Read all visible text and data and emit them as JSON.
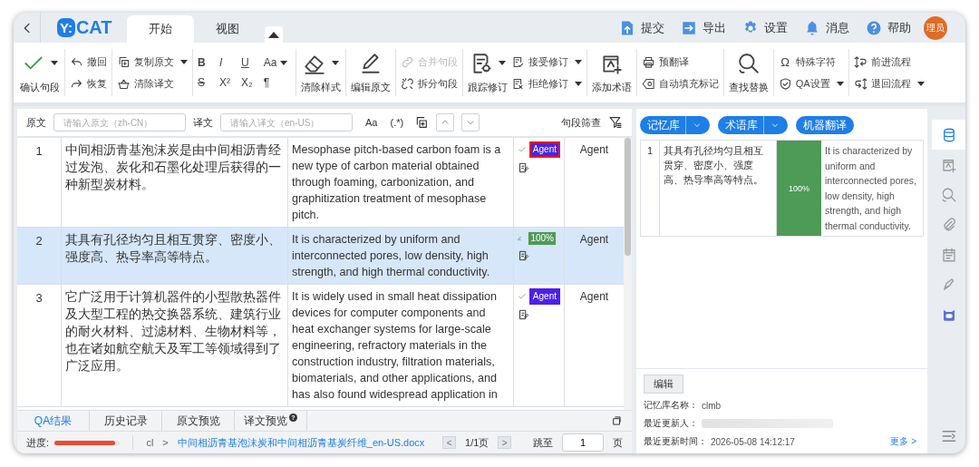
{
  "top_bar": {
    "logo_badge": "Y:",
    "logo_text": "CAT",
    "tabs": [
      {
        "label": "开始",
        "selected": true
      },
      {
        "label": "视图",
        "selected": false
      }
    ],
    "actions": [
      {
        "label": "提交"
      },
      {
        "label": "导出"
      },
      {
        "label": "设置"
      },
      {
        "label": "消息"
      },
      {
        "label": "帮助"
      }
    ],
    "avatar": "理员"
  },
  "ribbon": {
    "groups": [
      {
        "columns": [
          {
            "kind": "big",
            "label": "确认句段",
            "dropdown": true
          }
        ]
      },
      {
        "columns": [
          {
            "kind": "stack",
            "items": [
              {
                "label": "撤回"
              },
              {
                "label": "恢复"
              }
            ]
          }
        ]
      },
      {
        "columns": [
          {
            "kind": "stack",
            "items": [
              {
                "label": "复制原文",
                "dropdown": true
              },
              {
                "label": "清除译文"
              }
            ]
          }
        ]
      },
      {
        "columns": [
          {
            "kind": "grid",
            "items": [
              {
                "label": "B"
              },
              {
                "label": "I"
              },
              {
                "label": "U"
              },
              {
                "label": "Aa",
                "dropdown": true
              },
              {
                "label": "S"
              },
              {
                "label": "X²"
              },
              {
                "label": "X₂"
              },
              {
                "label": "¶"
              }
            ]
          }
        ]
      },
      {
        "columns": [
          {
            "kind": "big",
            "label": "清除样式",
            "dropdown": true
          }
        ]
      },
      {
        "columns": [
          {
            "kind": "big",
            "label": "编辑原文"
          }
        ]
      },
      {
        "columns": [
          {
            "kind": "stack",
            "items": [
              {
                "label": "合并句段",
                "disabled": true
              },
              {
                "label": "拆分句段"
              }
            ]
          }
        ]
      },
      {
        "columns": [
          {
            "kind": "big",
            "label": "跟踪修订",
            "dropdown": true
          },
          {
            "kind": "stack",
            "items": [
              {
                "label": "接受修订",
                "dropdown": true
              },
              {
                "label": "拒绝修订",
                "dropdown": true
              }
            ]
          }
        ]
      },
      {
        "columns": [
          {
            "kind": "big",
            "label": "添加术语"
          }
        ]
      },
      {
        "columns": [
          {
            "kind": "stack",
            "items": [
              {
                "label": "预翻译"
              },
              {
                "label": "自动填充标记"
              }
            ]
          }
        ]
      },
      {
        "columns": [
          {
            "kind": "big",
            "label": "查找替换"
          }
        ]
      },
      {
        "columns": [
          {
            "kind": "stack",
            "items": [
              {
                "label": "特殊字符",
                "glyph": "Ω"
              },
              {
                "label": "QA设置",
                "dropdown": true
              }
            ]
          }
        ]
      },
      {
        "columns": [
          {
            "kind": "stack",
            "items": [
              {
                "label": "前进流程"
              },
              {
                "label": "退回流程",
                "dropdown": true
              }
            ]
          }
        ]
      }
    ]
  },
  "filter_bar": {
    "source_label": "原文",
    "source_placeholder": "请输入原文（zh-CN）",
    "target_label": "译文",
    "target_placeholder": "请输入译文（en-US）",
    "case_button": "Aa",
    "regex_button": "(.*)",
    "filter_label": "句段筛查"
  },
  "segments": [
    {
      "number": "1",
      "source": "中间相沥青基泡沫炭是由中间相沥青经过发泡、炭化和石墨化处理后获得的一种新型炭材料。",
      "target": "Mesophase pitch-based carbon foam is a new type of carbon material obtained through foaming, carbonization, and graphitization treatment of mesophase pitch.",
      "confirmed": true,
      "match": {
        "label": "Agent",
        "kind": "agent"
      },
      "focused": true,
      "selected": false,
      "author": "Agent"
    },
    {
      "number": "2",
      "source": "其具有孔径均匀且相互贯穿、密度小、强度高、热导率高等特点。",
      "target": "It is characterized by uniform and interconnected pores, low density, high strength, and high thermal conductivity.",
      "confirmed": false,
      "match": {
        "label": "100%",
        "kind": "tm"
      },
      "selected": true,
      "author": "Agent"
    },
    {
      "number": "3",
      "source": "它广泛用于计算机器件的小型散热器件及大型工程的热交换器系统、建筑行业的耐火材料、过滤材料、生物材料等，也在诸如航空航天及军工等领域得到了广泛应用。",
      "target": "It is widely used in small heat dissipation devices for computer components and heat exchanger systems for large-scale engineering, refractory materials in the construction industry, filtration materials, biomaterials, and other applications, and has also found widespread application in",
      "confirmed": true,
      "match": {
        "label": "Agent",
        "kind": "agent"
      },
      "selected": false,
      "author": "Agent"
    }
  ],
  "bottom_tabs": [
    {
      "label": "QA结果",
      "selected": true
    },
    {
      "label": "历史记录",
      "selected": false
    },
    {
      "label": "原文预览",
      "selected": false
    },
    {
      "label": "译文预览",
      "selected": false,
      "badge": "?"
    }
  ],
  "status_bar": {
    "progress_label": "进度:",
    "progress": {
      "level": 0.93
    },
    "crumb": "cl",
    "crumb_separator": ">",
    "file": "中间相沥青基泡沫炭和中间相沥青基炭纤维_en-US.docx",
    "prev": "<",
    "page": "1/1页",
    "next": ">",
    "jump_label": "跳至",
    "jump_value": "1",
    "page_unit": "页"
  },
  "right_panel": {
    "sources": [
      {
        "label": "记忆库",
        "dropdown": true
      },
      {
        "label": "术语库",
        "dropdown": true
      },
      {
        "label": "机器翻译"
      }
    ],
    "matches": [
      {
        "number": "1",
        "source": "其具有孔径均匀且相互贯穿、密度小、强度高、热导率高等特点。",
        "score": "100%",
        "target": "It is characterized by uniform and interconnected pores, low density, high strength, and high thermal conductivity."
      }
    ],
    "edit_button": "编辑",
    "info": [
      {
        "label": "记忆库名称：",
        "value": "clmb"
      },
      {
        "label": "最近更新人：",
        "redacted": true
      },
      {
        "label": "最近更新时间：",
        "value": "2026-05-08 14:12:17"
      }
    ],
    "more_link": "更多 >"
  },
  "side_tools": [
    {
      "selected": true
    },
    {
      "selected": false
    },
    {
      "selected": false
    },
    {
      "selected": false
    },
    {
      "selected": false
    },
    {
      "selected": false
    },
    {
      "selected": false
    }
  ]
}
